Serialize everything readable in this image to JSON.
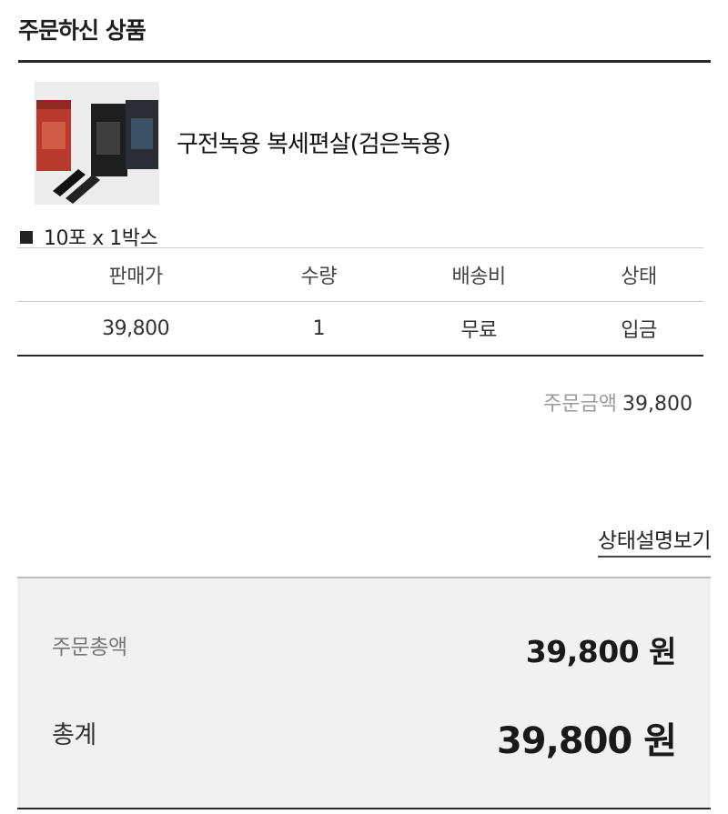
{
  "section": {
    "title": "주문하신 상품"
  },
  "product": {
    "name": "구전녹용 복세편살(검은녹용)",
    "option": "10포 x 1박스",
    "image_icon": "product-thumbnail"
  },
  "table": {
    "headers": [
      "판매가",
      "수량",
      "배송비",
      "상태"
    ],
    "row": {
      "price": "39,800",
      "quantity": "1",
      "shipping": "무료",
      "status": "입금"
    }
  },
  "order_amount": {
    "label": "주문금액",
    "value": "39,800"
  },
  "status_link": "상태설명보기",
  "summary": {
    "order_total_label": "주문총액",
    "order_total_value": "39,800 원",
    "grand_total_label": "총계",
    "grand_total_value": "39,800 원"
  },
  "colors": {
    "summary_bg": "#f1f1f1",
    "rule": "#2a2a2a",
    "muted": "#9a9a9a"
  }
}
